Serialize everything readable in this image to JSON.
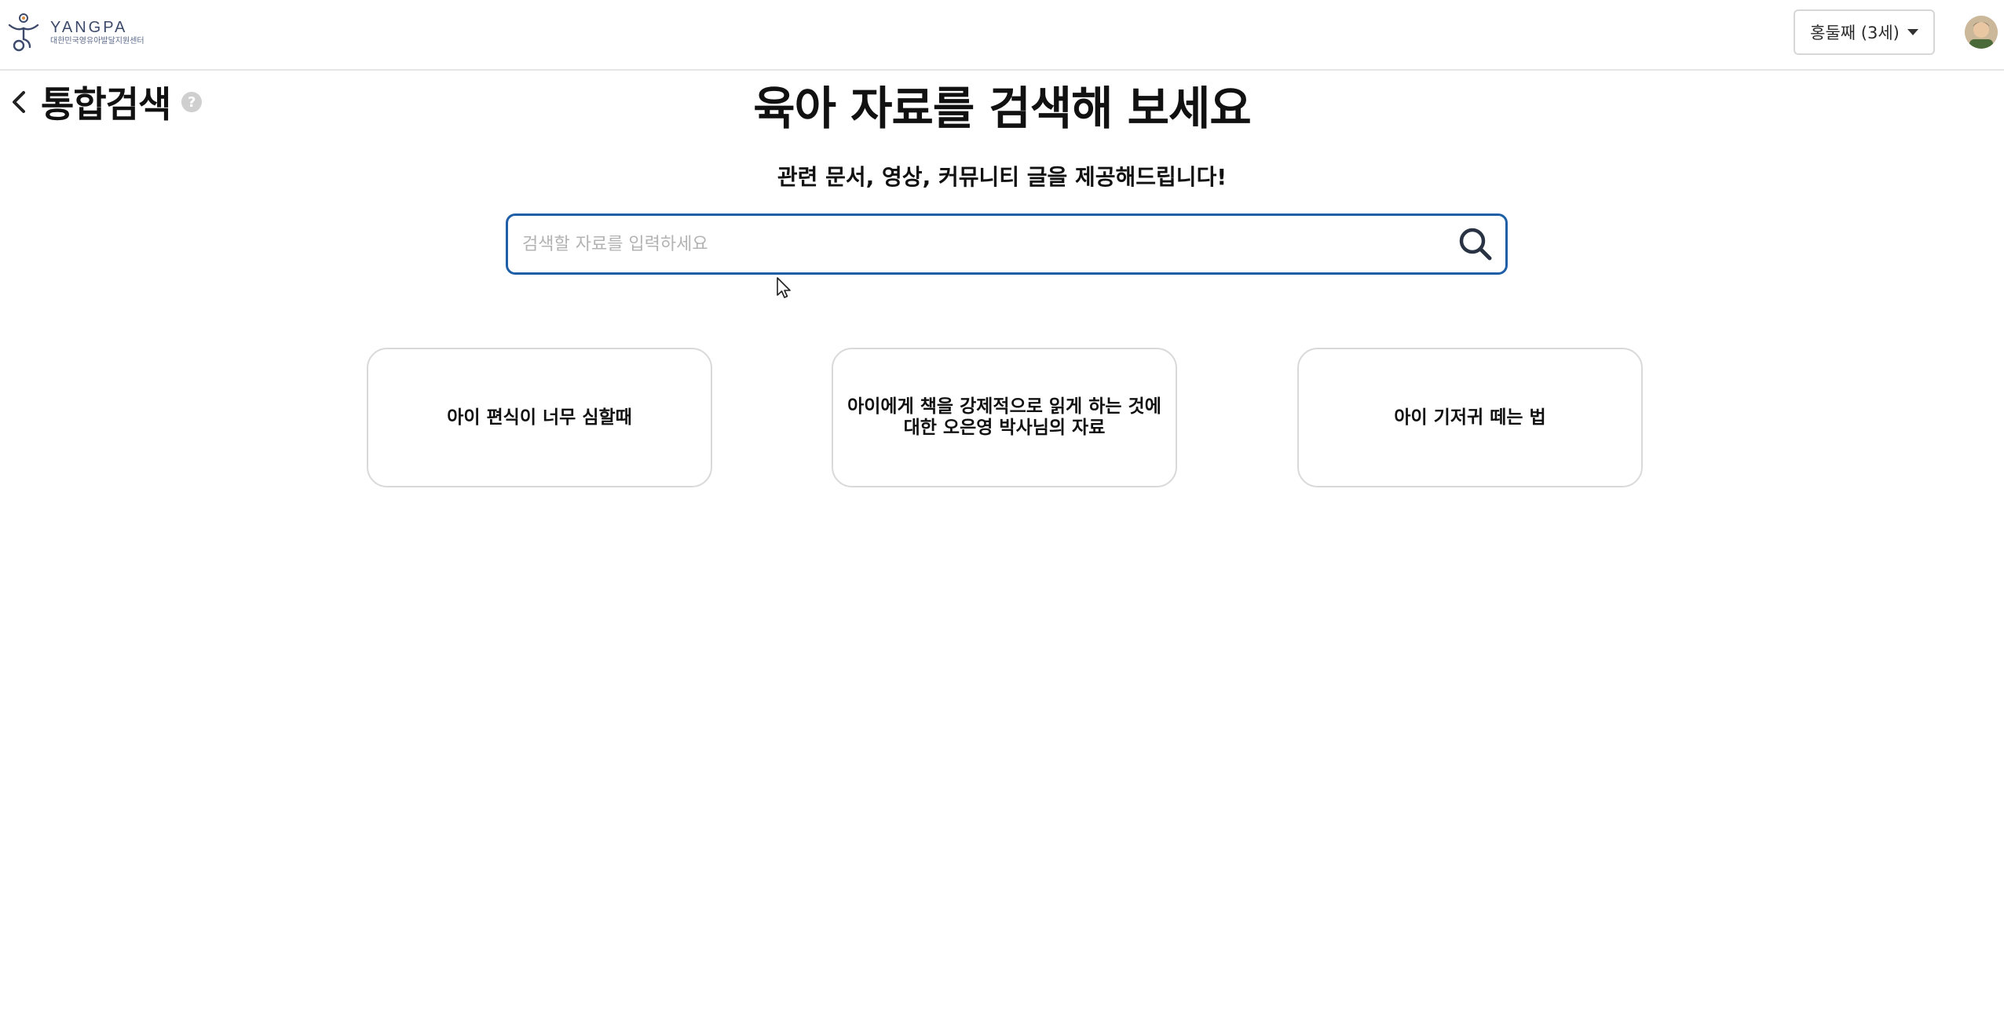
{
  "header": {
    "logo_title": "YANGPA",
    "logo_subtitle": "대한민국영유아발달지원센터",
    "child_selector": "홍둘째 (3세)"
  },
  "page": {
    "title": "통합검색",
    "help_symbol": "?",
    "headline": "육아 자료를 검색해 보세요",
    "subheadline": "관련 문서, 영상, 커뮤니티 글을 제공해드립니다!"
  },
  "search": {
    "placeholder": "검색할 자료를 입력하세요",
    "value": ""
  },
  "suggestions": [
    {
      "label": "아이 편식이 너무 심할때"
    },
    {
      "label": "아이에게 책을 강제적으로 읽게 하는 것에 대한 오은영 박사님의 자료"
    },
    {
      "label": "아이 기저귀 떼는 법"
    }
  ],
  "colors": {
    "search_border": "#1f5fa8",
    "logo": "#3d4a6b",
    "card_border": "#d9d9d9"
  },
  "icons": [
    "logo-mark-icon",
    "caret-down-icon",
    "avatar-image",
    "back-chevron-icon",
    "help-icon",
    "search-icon",
    "mouse-cursor-icon"
  ]
}
